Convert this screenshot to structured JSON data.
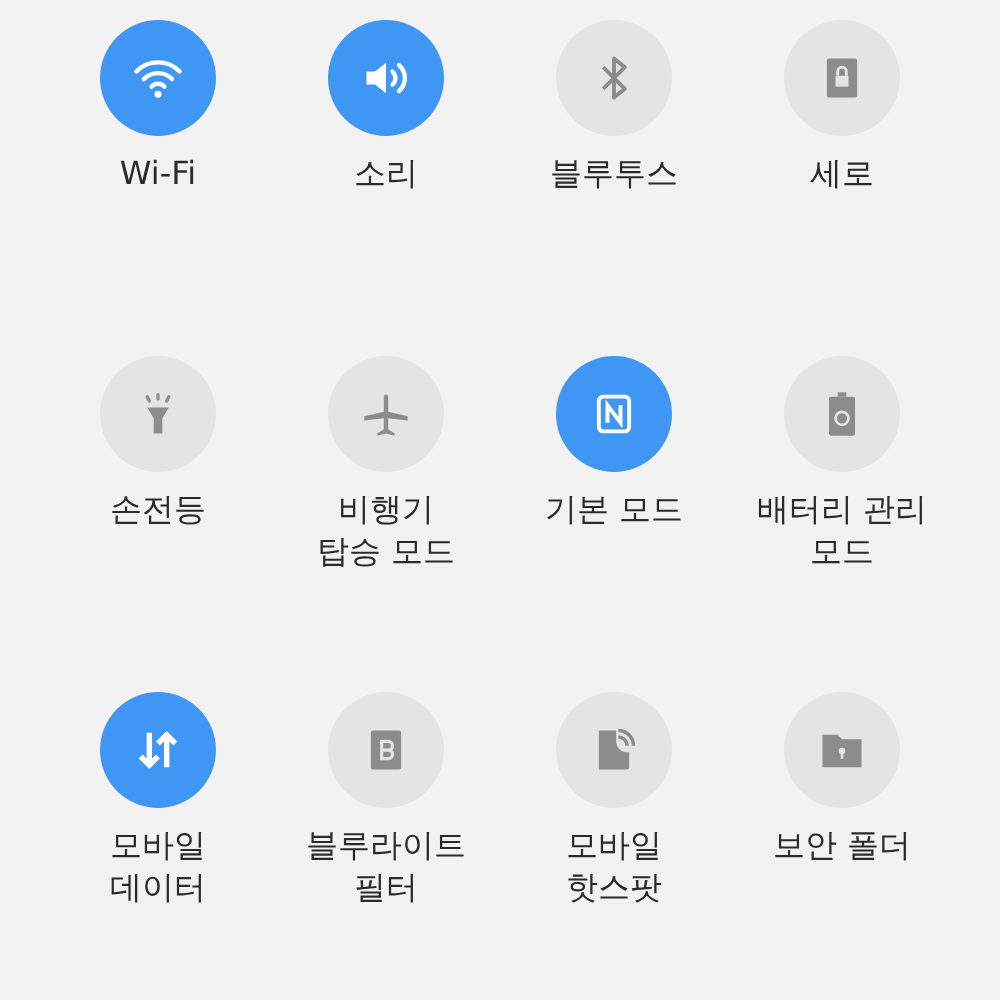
{
  "tiles": [
    {
      "kind": "wifi",
      "label": [
        "Wi-Fi"
      ],
      "on": true
    },
    {
      "kind": "sound",
      "label": [
        "소리"
      ],
      "on": true
    },
    {
      "kind": "bluetooth",
      "label": [
        "블루투스"
      ],
      "on": false
    },
    {
      "kind": "rotation",
      "label": [
        "세로"
      ],
      "on": false
    },
    {
      "kind": "flashlight",
      "label": [
        "손전등"
      ],
      "on": false
    },
    {
      "kind": "airplane",
      "label": [
        "비행기",
        "탑승 모드"
      ],
      "on": false
    },
    {
      "kind": "nfc",
      "label": [
        "기본 모드"
      ],
      "on": true
    },
    {
      "kind": "battery",
      "label": [
        "배터리 관리",
        "모드"
      ],
      "on": false
    },
    {
      "kind": "data",
      "label": [
        "모바일",
        "데이터"
      ],
      "on": true
    },
    {
      "kind": "bluelight",
      "label": [
        "블루라이트",
        "필터"
      ],
      "on": false
    },
    {
      "kind": "hotspot",
      "label": [
        "모바일",
        "핫스팟"
      ],
      "on": false
    },
    {
      "kind": "folder",
      "label": [
        "보안 폴더"
      ],
      "on": false
    }
  ]
}
